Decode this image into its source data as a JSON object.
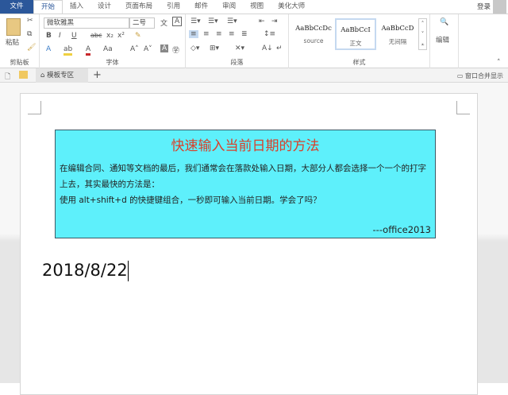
{
  "menu": {
    "tabs": [
      "文件",
      "开始",
      "插入",
      "设计",
      "页面布局",
      "引用",
      "邮件",
      "审阅",
      "视图",
      "美化大师"
    ],
    "login": "登录"
  },
  "ribbon": {
    "clipboard": {
      "paste": "粘贴",
      "label": "剪贴板"
    },
    "font": {
      "name": "微软雅黑",
      "size": "二号",
      "label": "字体"
    },
    "paragraph": {
      "label": "段落"
    },
    "styles": {
      "items": [
        {
          "preview": "AaBbCcDc",
          "name": "source"
        },
        {
          "preview": "AaBbCcI",
          "name": "正文"
        },
        {
          "preview": "AaBbCcD",
          "name": "无间隔"
        }
      ],
      "label": "样式"
    },
    "editing": {
      "label": "编辑"
    }
  },
  "doctabs": {
    "tab": "模板专区",
    "add": "+",
    "merge": "窗口合并显示"
  },
  "document": {
    "box_title": "快速输入当前日期的方法",
    "para1": "在编辑合同、通知等文档的最后，我们通常会在落款处输入日期，大部分人都会选择一个一个的打字上去，其实最快的方法是：",
    "para2": "使用 alt+shift+d 的快捷键组合，一秒即可输入当前日期。学会了吗？",
    "signature": "---office2013",
    "date": "2018/8/22"
  },
  "colors": {
    "file_tab": "#2b579a",
    "box_bg": "#5ef0fb",
    "title": "#d9402a"
  }
}
